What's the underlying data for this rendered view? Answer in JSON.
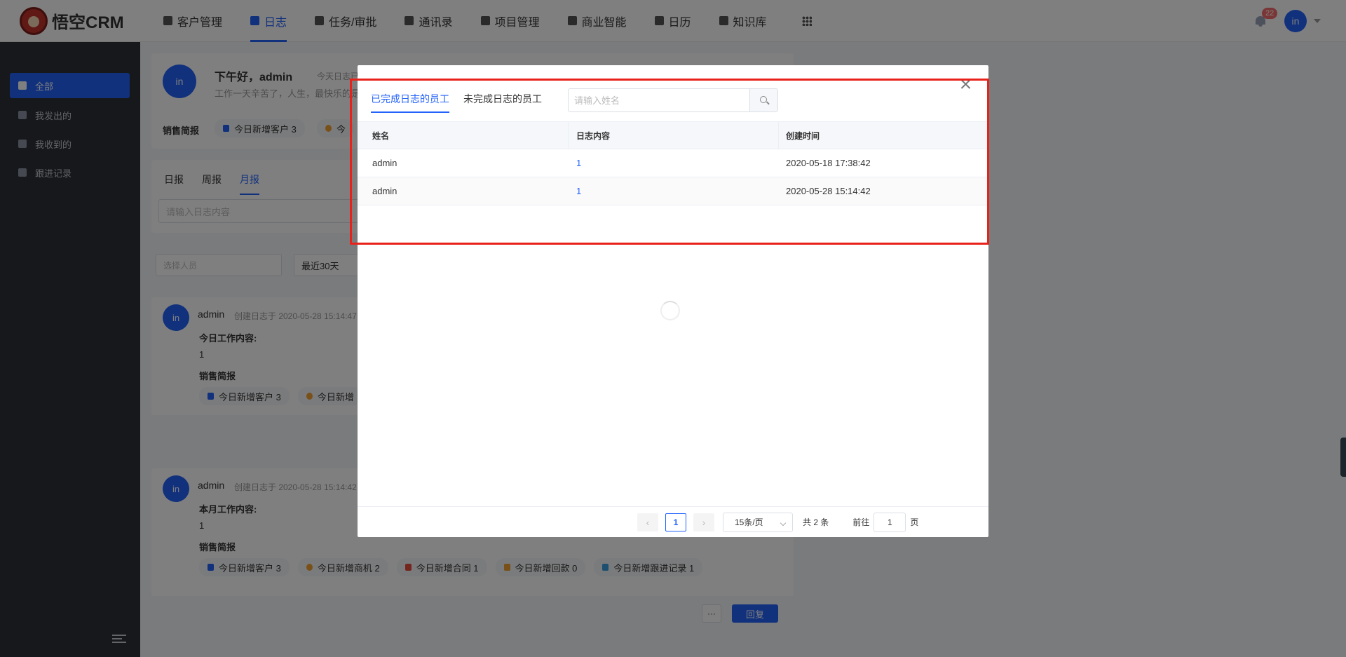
{
  "app": {
    "logo_text": "悟空CRM"
  },
  "nav": {
    "items": [
      {
        "label": "客户管理"
      },
      {
        "label": "日志",
        "active": true
      },
      {
        "label": "任务/审批"
      },
      {
        "label": "通讯录"
      },
      {
        "label": "项目管理"
      },
      {
        "label": "商业智能"
      },
      {
        "label": "日历"
      },
      {
        "label": "知识库"
      }
    ],
    "notification_count": "22",
    "avatar_text": "in"
  },
  "sidebar": {
    "items": [
      {
        "label": "全部",
        "active": true
      },
      {
        "label": "我发出的"
      },
      {
        "label": "我收到的"
      },
      {
        "label": "跟进记录"
      }
    ]
  },
  "background": {
    "greeting": "下午好，admin",
    "today_log_status": "今天日志已",
    "motto": "工作一天辛苦了，人生，最快乐的是",
    "sales_summary_label": "销售简报",
    "summary_chip_new_customers": "今日新增客户 3",
    "summary_chip_partial": "今",
    "tabs": [
      "日报",
      "周报",
      "月报"
    ],
    "log_input_placeholder": "请输入日志内容",
    "select_person_placeholder": "选择人员",
    "date_range": "最近30天",
    "avatar_text": "in",
    "log1": {
      "author": "admin",
      "created": "创建日志于 2020-05-28 15:14:47",
      "section_title": "今日工作内容:",
      "content": "1",
      "summary_label": "销售简报",
      "chips": [
        "今日新增客户 3",
        "今日新增"
      ]
    },
    "log2": {
      "author": "admin",
      "created": "创建日志于 2020-05-28 15:14:42",
      "section_title": "本月工作内容:",
      "content": "1",
      "summary_label": "销售简报",
      "chips": [
        "今日新增客户 3",
        "今日新增商机 2",
        "今日新增合同 1",
        "今日新增回款 0",
        "今日新增跟进记录 1"
      ],
      "more_label": "···",
      "reply_label": "回复"
    }
  },
  "dialog": {
    "tabs": [
      {
        "label": "已完成日志的员工",
        "active": true
      },
      {
        "label": "未完成日志的员工"
      }
    ],
    "search_placeholder": "请输入姓名",
    "table": {
      "headers": [
        "姓名",
        "日志内容",
        "创建时间"
      ],
      "rows": [
        {
          "name": "admin",
          "content": "1",
          "created": "2020-05-18 17:38:42"
        },
        {
          "name": "admin",
          "content": "1",
          "created": "2020-05-28 15:14:42"
        }
      ]
    },
    "pagination": {
      "prev": "‹",
      "current_page": "1",
      "next": "›",
      "page_size": "15条/页",
      "total": "共 2 条",
      "goto_label": "前往",
      "goto_value": "1",
      "page_suffix": "页"
    }
  },
  "colors": {
    "primary": "#2362fb",
    "sidebar_bg": "#2d3037",
    "highlight_border": "#e8221a"
  }
}
